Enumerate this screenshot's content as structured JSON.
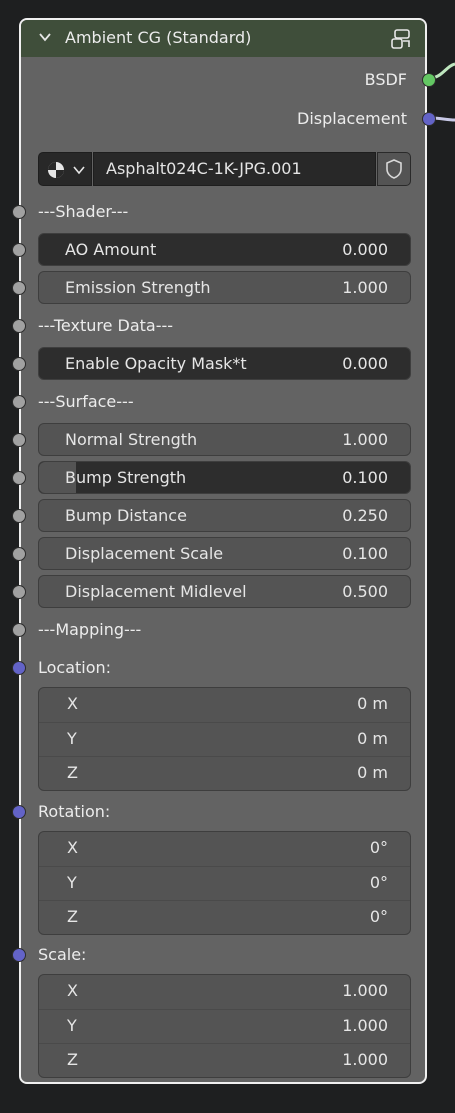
{
  "node": {
    "title": "Ambient CG (Standard)",
    "header_color": "#3f4e3a"
  },
  "outputs": {
    "bsdf": "BSDF",
    "displacement": "Displacement"
  },
  "datablock": {
    "name": "Asphalt024C-1K-JPG.001"
  },
  "sections": {
    "shader": "---Shader---",
    "texture_data": "---Texture Data---",
    "surface": "---Surface---",
    "mapping": "---Mapping---"
  },
  "fields": {
    "ao_amount": {
      "label": "AO Amount",
      "value": "0.000"
    },
    "emission_strength": {
      "label": "Emission Strength",
      "value": "1.000"
    },
    "enable_opacity_mask": {
      "label": "Enable Opacity Mask*t",
      "value": "0.000"
    },
    "normal_strength": {
      "label": "Normal Strength",
      "value": "1.000"
    },
    "bump_strength": {
      "label": "Bump Strength",
      "value": "0.100"
    },
    "bump_distance": {
      "label": "Bump Distance",
      "value": "0.250"
    },
    "displacement_scale": {
      "label": "Displacement Scale",
      "value": "0.100"
    },
    "displacement_midlevel": {
      "label": "Displacement Midlevel",
      "value": "0.500"
    }
  },
  "vectors": {
    "location": {
      "label": "Location:",
      "x": "0 m",
      "y": "0 m",
      "z": "0 m"
    },
    "rotation": {
      "label": "Rotation:",
      "x": "0°",
      "y": "0°",
      "z": "0°"
    },
    "scale": {
      "label": "Scale:",
      "x": "1.000",
      "y": "1.000",
      "z": "1.000"
    }
  },
  "axis_labels": {
    "x": "X",
    "y": "Y",
    "z": "Z"
  },
  "colors": {
    "socket_shader": "#63c763",
    "socket_vector": "#6363c7",
    "socket_float": "#a1a1a1"
  }
}
